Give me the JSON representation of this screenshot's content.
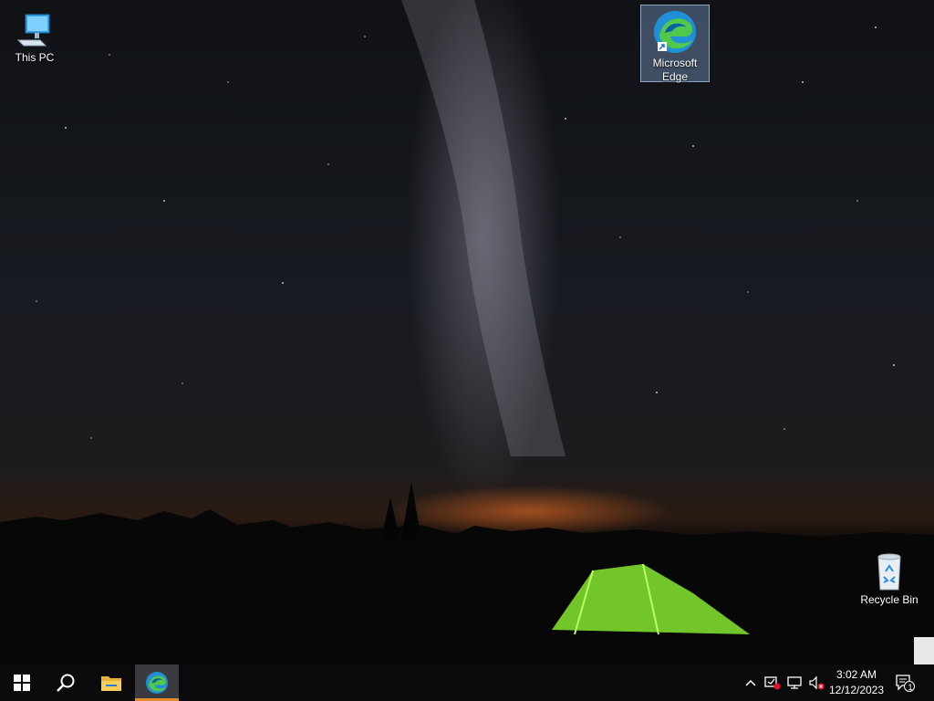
{
  "desktop": {
    "icons": [
      {
        "label": "This PC",
        "icon": "this-pc-icon"
      },
      {
        "label": "Microsoft Edge",
        "icon": "edge-icon",
        "selected": true
      },
      {
        "label": "Recycle Bin",
        "icon": "recycle-bin-icon"
      }
    ],
    "wallpaper": "night-sky-milky-way-tent"
  },
  "taskbar": {
    "start": "windows-start-icon",
    "search": "search-icon",
    "pinned": [
      {
        "name": "File Explorer",
        "icon": "file-explorer-icon"
      },
      {
        "name": "Microsoft Edge",
        "icon": "edge-icon",
        "active": true
      }
    ],
    "tray": {
      "overflow": "chevron-up-icon",
      "icons": [
        "security-alert-icon",
        "network-icon",
        "volume-muted-icon"
      ],
      "time": "3:02 AM",
      "date": "12/12/2023",
      "notifications_count": "1"
    },
    "accent_color": "#e3892f"
  }
}
